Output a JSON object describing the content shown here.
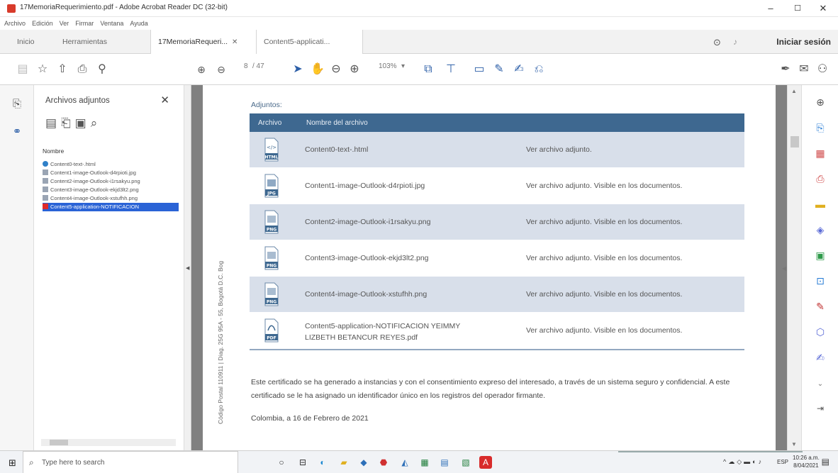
{
  "window": {
    "title": "17MemoriaRequerimiento.pdf - Adobe Acrobat Reader DC (32-bit)",
    "controls": {
      "minimize": "–",
      "maximize": "☐",
      "close": "✕"
    }
  },
  "menu": [
    "Archivo",
    "Edición",
    "Ver",
    "Firmar",
    "Ventana",
    "Ayuda"
  ],
  "tabs": {
    "home": "Inicio",
    "tools": "Herramientas",
    "doc1": "17MemoriaRequeri...",
    "doc1_close": "✕",
    "doc2": "Content5-applicati...",
    "help_icon": "help-icon",
    "bell_icon": "bell-icon",
    "signin": "Iniciar sesión"
  },
  "toolbar": {
    "page_current": "8",
    "page_total": "/ 47",
    "zoom": "103%",
    "zoom_arrow": "▾"
  },
  "attachments_panel": {
    "title": "Archivos adjuntos",
    "close": "✕",
    "column_header": "Nombre",
    "items": [
      "Content0-text-.html",
      "Content1-image-Outlook-d4rpioti.jpg",
      "Content2-image-Outlook-i1rsakyu.png",
      "Content3-image-Outlook-ekjd3lt2.png",
      "Content4-image-Outlook-xstufhh.png",
      "Content5-application-NOTIFICACION"
    ],
    "selected_index": 5
  },
  "document": {
    "side_text": "Código Postal 110911 | Diag. 25G 95A - 55, Bogotá D.C. Bog",
    "attachments_label": "Adjuntos:",
    "table": {
      "col_file": "Archivo",
      "col_name": "Nombre del archivo",
      "rows": [
        {
          "type": "HTML",
          "name": "Content0-text-.html",
          "desc": "Ver archivo adjunto."
        },
        {
          "type": "JPG",
          "name": "Content1-image-Outlook-d4rpioti.jpg",
          "desc": "Ver archivo adjunto.  Visible en los documentos."
        },
        {
          "type": "PNG",
          "name": "Content2-image-Outlook-i1rsakyu.png",
          "desc": "Ver archivo adjunto.  Visible en los documentos."
        },
        {
          "type": "PNG",
          "name": "Content3-image-Outlook-ekjd3lt2.png",
          "desc": "Ver archivo adjunto.  Visible en los documentos."
        },
        {
          "type": "PNG",
          "name": "Content4-image-Outlook-xstufhh.png",
          "desc": "Ver archivo adjunto.  Visible en los documentos."
        },
        {
          "type": "PDF",
          "name_line1": "Content5-application-NOTIFICACION YEIMMY",
          "name_line2": "LIZBETH BETANCUR REYES.pdf",
          "desc": "Ver archivo adjunto.  Visible en los documentos."
        }
      ]
    },
    "paragraph": "Este certificado se ha generado a instancias y con el consentimiento expreso del interesado, a través de un sistema seguro y confidencial. A este certificado se le ha asignado un identificador único en los registros del operador firmante.",
    "date_line": "Colombia, a 16 de Febrero de 2021"
  },
  "taskbar": {
    "search_placeholder": "Type here to search",
    "tray_lang": "ESP",
    "time": "10:26 a.m.",
    "date": "8/04/2021"
  },
  "colors": {
    "table_header": "#3e6890",
    "row_alt": "#d8dfea",
    "selection": "#2a63d6",
    "pdf_red": "#e02b2b"
  }
}
